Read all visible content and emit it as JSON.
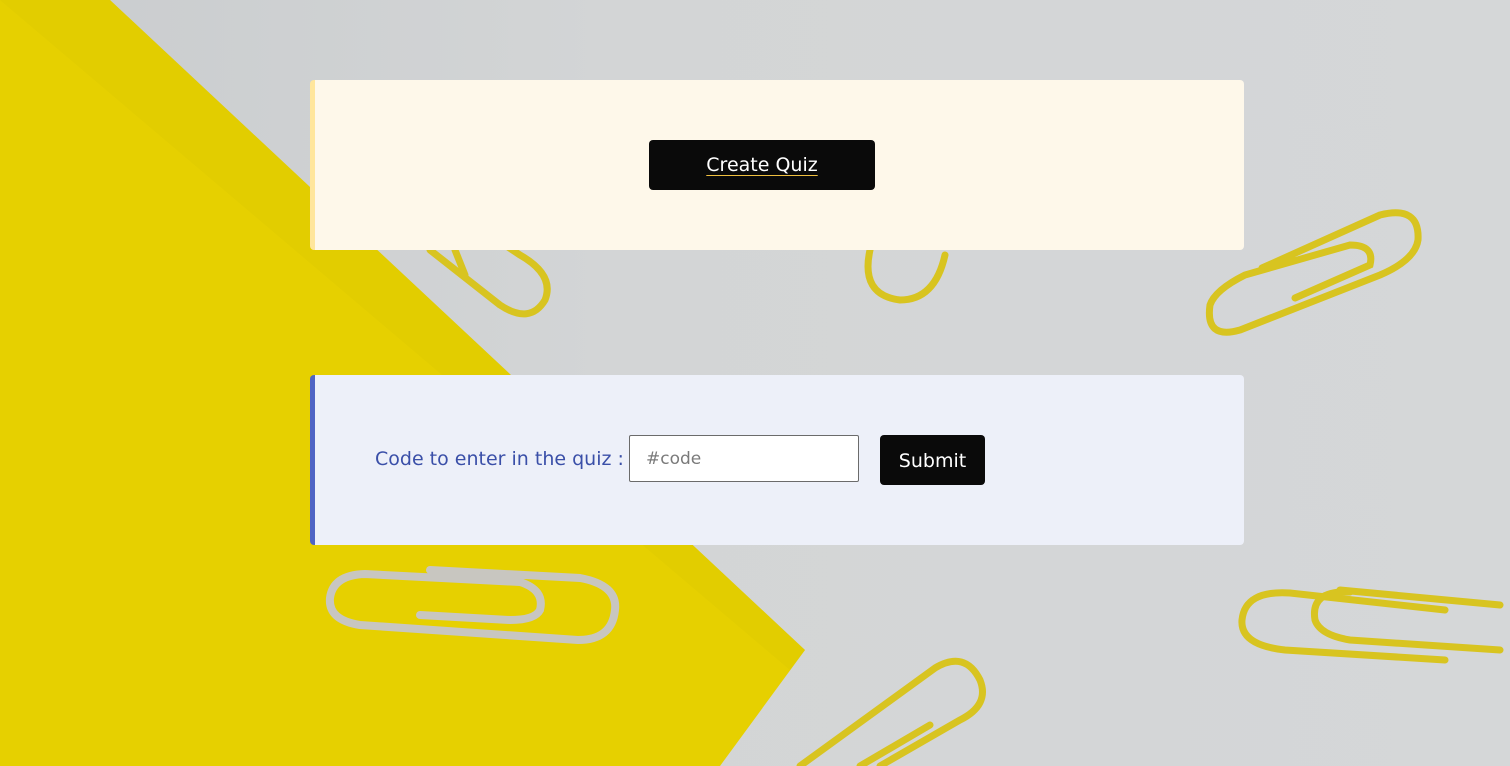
{
  "create_card": {
    "button_label": "Create Quiz"
  },
  "join_card": {
    "label": "Code to enter in the quiz :",
    "input_placeholder": "#code",
    "input_value": "",
    "submit_label": "Submit"
  },
  "colors": {
    "create_card_bg": "#fef8ea",
    "create_card_accent": "#ffe69c",
    "join_card_bg": "#edf0f9",
    "join_card_accent": "#4f64c4",
    "button_bg": "#0a0a0a",
    "label_text": "#3a4fa8",
    "paper_yellow": "#e8d200",
    "clip_yellow": "#d8c420"
  },
  "icons": {
    "background": "paperclips-on-yellow-paper-image"
  }
}
